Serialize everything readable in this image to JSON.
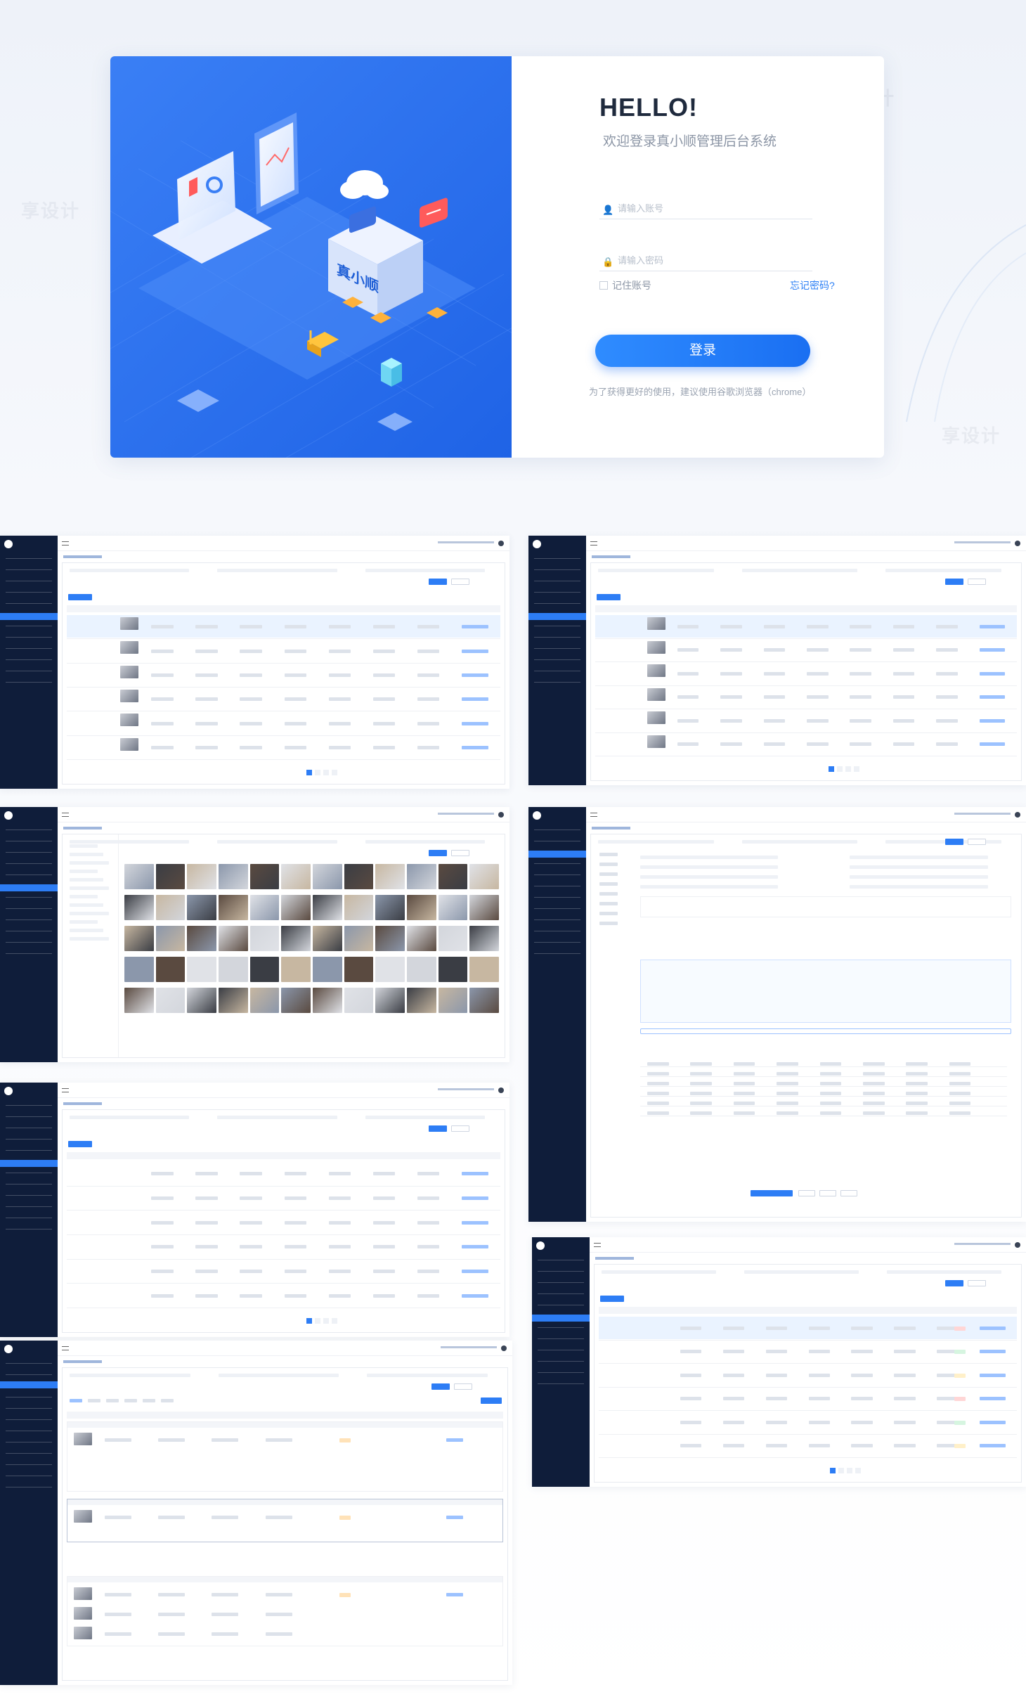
{
  "login": {
    "greeting": "HELLO!",
    "subtitle": "欢迎登录真小顺管理后台系统",
    "account_placeholder": "请输入账号",
    "password_placeholder": "请输入密码",
    "remember_label": "记住账号",
    "forgot_label": "忘记密码?",
    "login_button": "登录",
    "browser_tip": "为了获得更好的使用，建议使用谷歌浏览器（chrome）",
    "hero_sign": "真小顺",
    "hero_icons": [
      "laptop-icon",
      "phone-icon",
      "cloud-icon",
      "chat-icon",
      "warehouse-icon",
      "forklift-icon"
    ]
  },
  "watermark": "享设计",
  "colors": {
    "primary": "#2d7df5",
    "sidebar": "#0f1d3a",
    "hero": "#2a6ff0"
  },
  "dashboards": [
    {
      "id": "product-list-a",
      "type": "table"
    },
    {
      "id": "product-list-b",
      "type": "table"
    },
    {
      "id": "image-library",
      "type": "gallery"
    },
    {
      "id": "product-form",
      "type": "form"
    },
    {
      "id": "category-list",
      "type": "table"
    },
    {
      "id": "order-table",
      "type": "table"
    },
    {
      "id": "order-cards",
      "type": "list"
    }
  ]
}
